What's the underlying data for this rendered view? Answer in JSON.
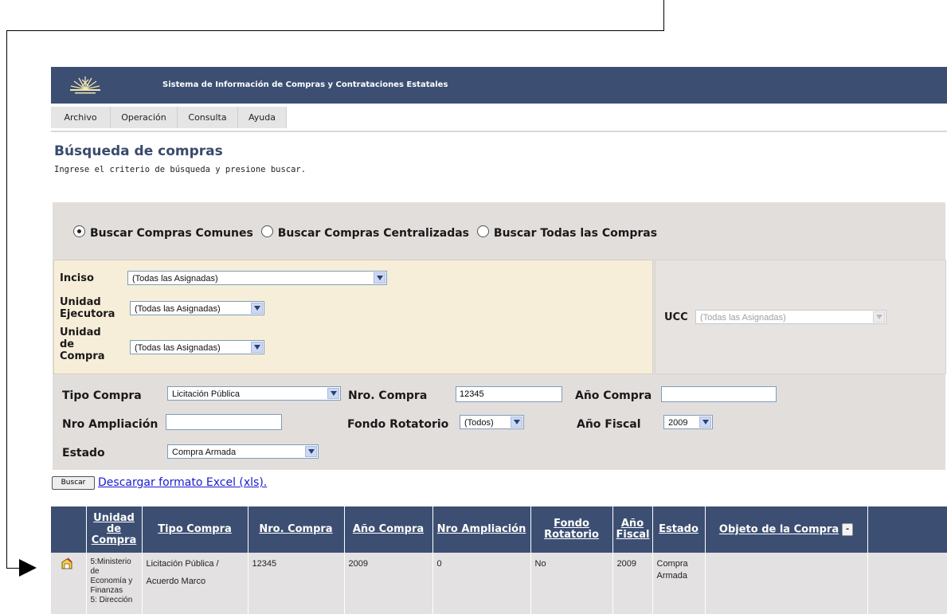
{
  "header": {
    "title": "Sistema de Información de Compras y Contrataciones Estatales"
  },
  "menu": [
    {
      "label": "Archivo"
    },
    {
      "label": "Operación"
    },
    {
      "label": "Consulta"
    },
    {
      "label": "Ayuda"
    }
  ],
  "page": {
    "title": "Búsqueda de compras",
    "subtitle": "Ingrese el criterio de búsqueda y presione buscar."
  },
  "search_scope": {
    "options": [
      {
        "label": "Buscar Compras Comunes",
        "checked": true
      },
      {
        "label": "Buscar Compras Centralizadas",
        "checked": false
      },
      {
        "label": "Buscar Todas las Compras",
        "checked": false
      }
    ]
  },
  "filters": {
    "inciso": {
      "label": "Inciso",
      "value": "(Todas las Asignadas)"
    },
    "unidad_ejecutora": {
      "label1": "Unidad",
      "label2": "Ejecutora",
      "value": "(Todas las Asignadas)"
    },
    "unidad_compra": {
      "label1": "Unidad",
      "label2": "de",
      "label3": "Compra",
      "value": "(Todas las Asignadas)"
    },
    "ucc": {
      "label": "UCC",
      "value": "(Todas las Asignadas)"
    },
    "tipo_compra": {
      "label": "Tipo Compra",
      "value": "Licitación Pública"
    },
    "nro_compra": {
      "label": "Nro. Compra",
      "value": "12345"
    },
    "anio_compra": {
      "label": "Año Compra",
      "value": ""
    },
    "nro_ampliacion": {
      "label": "Nro Ampliación",
      "value": ""
    },
    "fondo_rotatorio": {
      "label": "Fondo Rotatorio",
      "value": "(Todos)"
    },
    "anio_fiscal": {
      "label": "Año Fiscal",
      "value": "2009"
    },
    "estado": {
      "label": "Estado",
      "value": "Compra Armada"
    }
  },
  "actions": {
    "buscar": "Buscar",
    "excel": "Descargar formato Excel (xls)."
  },
  "results": {
    "headers": {
      "unidad_compra": "Unidad de Compra",
      "tipo_compra": "Tipo Compra",
      "nro_compra": "Nro. Compra",
      "anio_compra": "Año Compra",
      "nro_ampliacion": "Nro Ampliación",
      "fondo_rotatorio": "Fondo Rotatorio",
      "anio_fiscal": "Año Fiscal",
      "estado": "Estado",
      "objeto": "Objeto de la Compra",
      "collapse": "-"
    },
    "row": {
      "unidad_line1": "5:Ministerio de",
      "unidad_line2": "Economía y",
      "unidad_line3": "Finanzas",
      "unidad_line4": "5: Dirección",
      "tipo_line1": "Licitación Pública /",
      "tipo_line2": "Acuerdo Marco",
      "nro_compra": "12345",
      "anio_compra": "2009",
      "nro_ampliacion": "0",
      "fondo_rotatorio": "No",
      "anio_fiscal": "2009",
      "estado_line1": "Compra",
      "estado_line2": "Armada",
      "objeto": ""
    }
  },
  "colors": {
    "header_bg": "#3c4f72",
    "panel_bg": "#e2dedc",
    "yellow_bg": "#f6eed8",
    "title_color": "#394a6c",
    "link_color": "#1a1ad0"
  }
}
